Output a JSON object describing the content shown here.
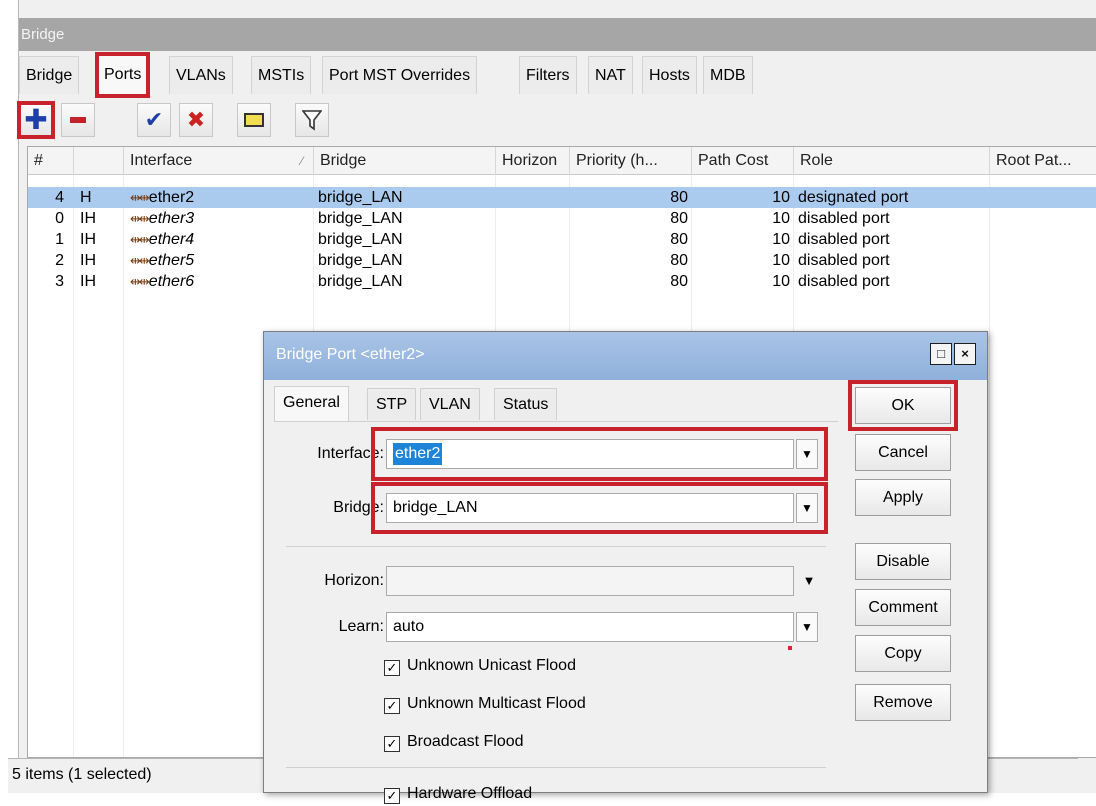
{
  "window": {
    "title": "Bridge"
  },
  "tabs": [
    {
      "label": "Bridge"
    },
    {
      "label": "Ports"
    },
    {
      "label": "VLANs"
    },
    {
      "label": "MSTIs"
    },
    {
      "label": "Port MST Overrides"
    },
    {
      "label": "Filters"
    },
    {
      "label": "NAT"
    },
    {
      "label": "Hosts"
    },
    {
      "label": "MDB"
    }
  ],
  "active_tab": "Ports",
  "toolbar": {
    "add": "add-icon",
    "remove": "remove-icon",
    "enable": "check-icon",
    "disable": "x-icon",
    "comment": "comment-icon",
    "filter": "filter-icon"
  },
  "table": {
    "columns": [
      "#",
      "",
      "Interface",
      "Bridge",
      "Horizon",
      "Priority (h...",
      "Path Cost",
      "Role",
      "Root Pat..."
    ],
    "rows": [
      {
        "num": "4",
        "flags": "H",
        "iface": "ether2",
        "bridge": "bridge_LAN",
        "horizon": "",
        "priority": "80",
        "cost": "10",
        "role": "designated port",
        "root": "",
        "selected": true
      },
      {
        "num": "0",
        "flags": "IH",
        "iface": "ether3",
        "bridge": "bridge_LAN",
        "horizon": "",
        "priority": "80",
        "cost": "10",
        "role": "disabled port",
        "root": ""
      },
      {
        "num": "1",
        "flags": "IH",
        "iface": "ether4",
        "bridge": "bridge_LAN",
        "horizon": "",
        "priority": "80",
        "cost": "10",
        "role": "disabled port",
        "root": ""
      },
      {
        "num": "2",
        "flags": "IH",
        "iface": "ether5",
        "bridge": "bridge_LAN",
        "horizon": "",
        "priority": "80",
        "cost": "10",
        "role": "disabled port",
        "root": ""
      },
      {
        "num": "3",
        "flags": "IH",
        "iface": "ether6",
        "bridge": "bridge_LAN",
        "horizon": "",
        "priority": "80",
        "cost": "10",
        "role": "disabled port",
        "root": ""
      }
    ]
  },
  "status": {
    "text": "5 items (1 selected)"
  },
  "dialog": {
    "title": "Bridge Port <ether2>",
    "restore_glyph": "□",
    "close_glyph": "×",
    "tabs": [
      "General",
      "STP",
      "VLAN",
      "Status"
    ],
    "fields": {
      "interface_label": "Interface:",
      "interface_value": "ether2",
      "bridge_label": "Bridge:",
      "bridge_value": "bridge_LAN",
      "horizon_label": "Horizon:",
      "horizon_value": "",
      "learn_label": "Learn:",
      "learn_value": "auto"
    },
    "checkboxes": [
      {
        "label": "Unknown Unicast Flood",
        "checked": true
      },
      {
        "label": "Unknown Multicast Flood",
        "checked": true
      },
      {
        "label": "Broadcast Flood",
        "checked": true
      },
      {
        "label": "Hardware Offload",
        "checked": true
      }
    ],
    "buttons": [
      "OK",
      "Cancel",
      "Apply",
      "Disable",
      "Comment",
      "Copy",
      "Remove"
    ]
  },
  "colors": {
    "highlight": "#c8232c",
    "selection": "#aacbed",
    "dialog_title": "#8fb0db"
  }
}
